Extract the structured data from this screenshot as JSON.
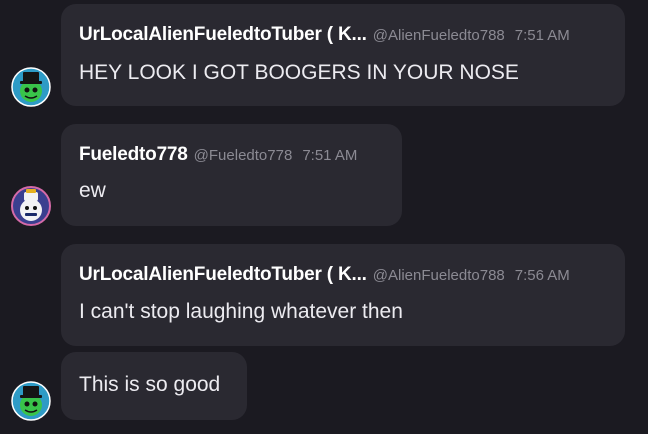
{
  "messages": [
    {
      "author": "UrLocalAlienFueledtoTuber ( K...",
      "handle": "@AlienFueledto788",
      "time": "7:51 AM",
      "text": "HEY LOOK I GOT BOOGERS IN YOUR NOSE",
      "avatar": "green-alien-avatar"
    },
    {
      "author": "Fueledto778",
      "handle": "@Fueledto778",
      "time": "7:51 AM",
      "text": "ew",
      "avatar": "white-bird-avatar"
    },
    {
      "author": "UrLocalAlienFueledtoTuber ( K...",
      "handle": "@AlienFueledto788",
      "time": "7:56 AM",
      "text": "I can't stop laughing whatever then",
      "avatar": "green-alien-avatar"
    },
    {
      "text": "This is so good",
      "avatar": "green-alien-avatar"
    }
  ],
  "colors": {
    "background": "#1b1a21",
    "bubble": "#2a2931",
    "name": "#ffffff",
    "meta": "#8b8a93",
    "text": "#ecebf0"
  }
}
